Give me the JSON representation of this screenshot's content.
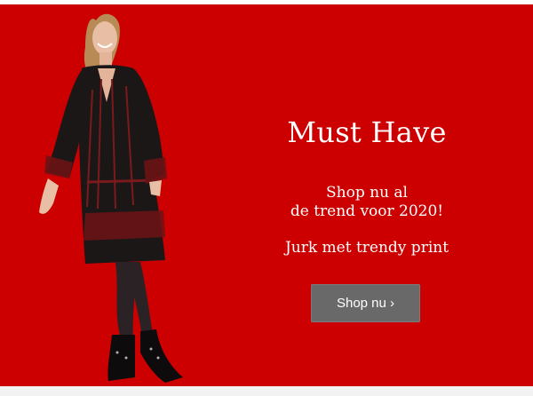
{
  "banner": {
    "background_color": "#cc0000",
    "headline": "Must Have",
    "subline_1": "Shop nu al",
    "subline_2": "de trend voor 2020!",
    "tagline": "Jurk met trendy print",
    "cta_label": "Shop nu ›",
    "cta_color": "#696969"
  },
  "image": {
    "subject": "model-in-black-red-print-dress-icon"
  }
}
